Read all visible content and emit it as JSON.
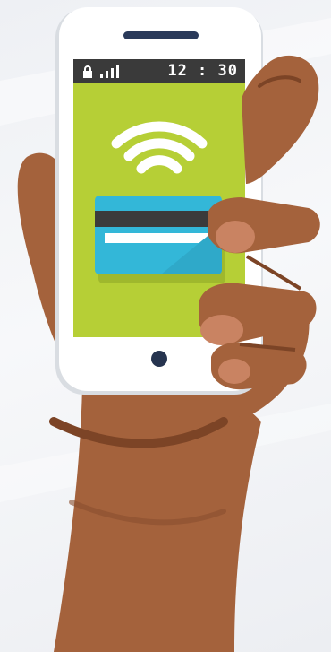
{
  "phone": {
    "status_time": "12 : 30",
    "icons": [
      "lock-icon",
      "signal-icon",
      "nfc-wireless-icon",
      "credit-card-icon",
      "home-button-icon"
    ],
    "screen_color": "#b6cf36",
    "card_color": "#33b7d8",
    "card_stripe_color": "#3b3b3b"
  },
  "hand": {
    "skin_color": "#a4623c",
    "nail_color": "#c98362"
  },
  "colors": {
    "phone_body": "#ffffff",
    "status_bar": "#3a3a3a"
  }
}
